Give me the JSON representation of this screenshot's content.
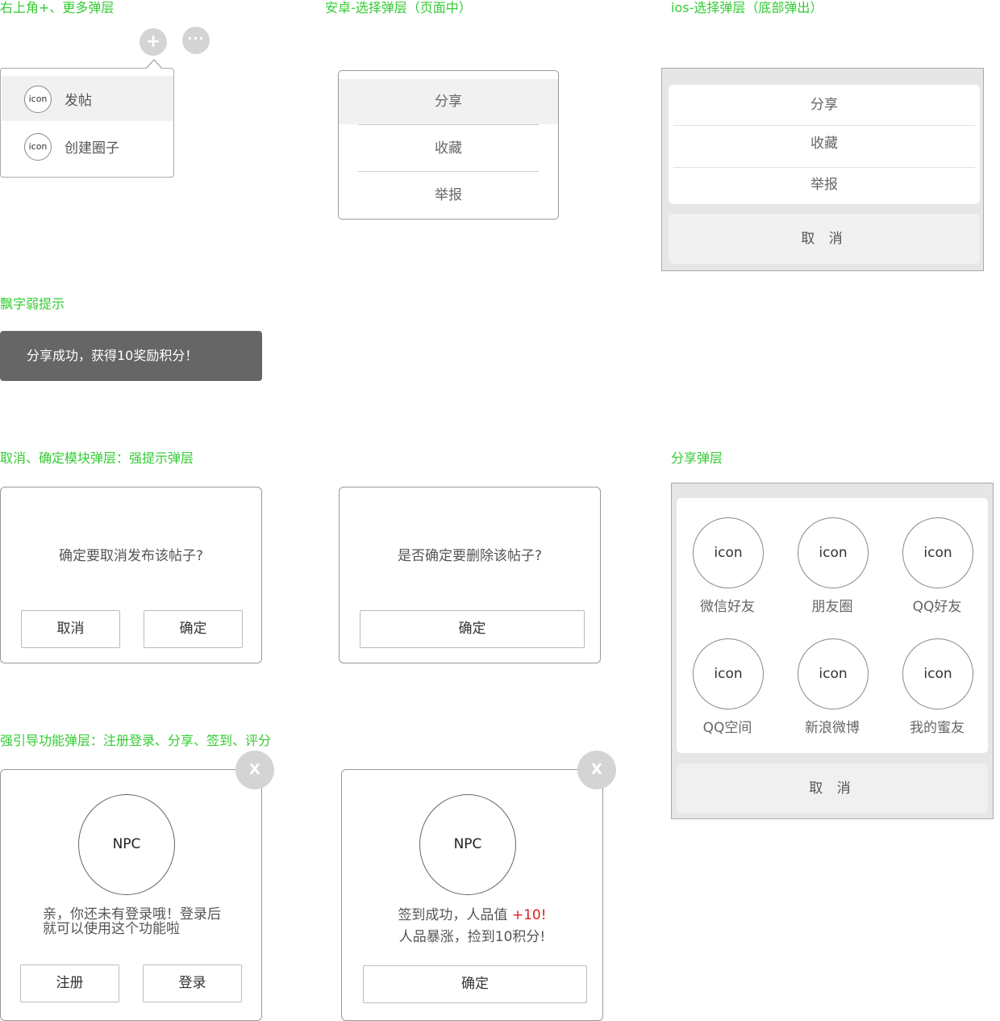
{
  "sections": {
    "top_menu": "右上角+、更多弹层",
    "android_select": "安卓-选择弹层（页面中）",
    "ios_select": "ios-选择弹层（底部弹出）",
    "toast": "飘字弱提示",
    "confirm": "取消、确定模块弹层：强提示弹层",
    "share": "分享弹层",
    "guide": "强引导功能弹层：注册登录、分享、签到、评分"
  },
  "top_menu": {
    "plus_glyph": "+",
    "more_glyph": "···",
    "items": [
      {
        "icon": "icon",
        "label": "发帖"
      },
      {
        "icon": "icon",
        "label": "创建圈子"
      }
    ]
  },
  "android_select": {
    "items": [
      "分享",
      "收藏",
      "举报"
    ]
  },
  "ios_select": {
    "items": [
      "分享",
      "收藏",
      "举报"
    ],
    "cancel": "取 消"
  },
  "toast": {
    "text": "分享成功，获得10奖励积分！"
  },
  "confirm_dialogs": [
    {
      "message": "确定要取消发布该帖子?",
      "cancel": "取消",
      "ok": "确定"
    },
    {
      "message": "是否确定要删除该帖子?",
      "ok": "确定"
    }
  ],
  "share_sheet": {
    "items": [
      {
        "icon": "icon",
        "label": "微信好友"
      },
      {
        "icon": "icon",
        "label": "朋友圈"
      },
      {
        "icon": "icon",
        "label": "QQ好友"
      },
      {
        "icon": "icon",
        "label": "QQ空间"
      },
      {
        "icon": "icon",
        "label": "新浪微博"
      },
      {
        "icon": "icon",
        "label": "我的蜜友"
      }
    ],
    "cancel": "取 消"
  },
  "guide_dialogs": [
    {
      "close": "X",
      "npc": "NPC",
      "line1": "亲，你还未有登录哦！登录后",
      "line2": "就可以使用这个功能啦",
      "register": "注册",
      "login": "登录"
    },
    {
      "close": "X",
      "npc": "NPC",
      "line1_prefix": "签到成功，人品值 ",
      "line1_highlight": "+10!",
      "line2": "人品暴涨，捡到10积分!",
      "ok": "确定"
    }
  ],
  "colors": {
    "section_title": "#33cc33",
    "toast_bg": "#666666",
    "highlight_red": "#e02020"
  }
}
